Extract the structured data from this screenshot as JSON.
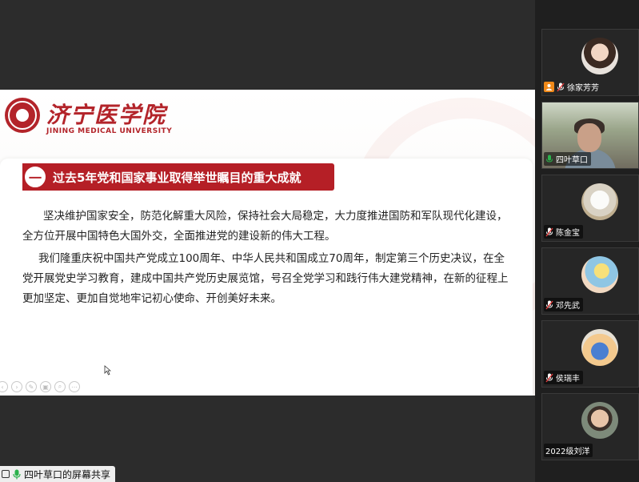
{
  "slide": {
    "logo_cn": "济宁医学院",
    "logo_en": "JINING MEDICAL UNIVERSITY",
    "heading_badge": "一",
    "heading": "过去5年党和国家事业取得举世瞩目的重大成就",
    "paragraph1": "坚决维护国家安全，防范化解重大风险，保持社会大局稳定，大力度推进国防和军队现代化建设，全方位开展中国特色大国外交，全面推进党的建设新的伟大工程。",
    "paragraph2": "我们隆重庆祝中国共产党成立100周年、中华人民共和国成立70周年，制定第三个历史决议，在全党开展党史学习教育，建成中国共产党历史展览馆，号召全党学习和践行伟大建党精神，在新的征程上更加坚定、更加自觉地牢记初心使命、开创美好未来。",
    "controls": [
      "‹",
      "›",
      "✎",
      "▣",
      "⌕",
      "⋯"
    ]
  },
  "screen_share_label": "四叶草口的屏幕共享",
  "participants": [
    {
      "name": "徐家芳芳",
      "avatar": "woman-photo",
      "host": true,
      "mic": "muted"
    },
    {
      "name": "四叶草口",
      "avatar": "video",
      "host": false,
      "mic": "on",
      "active": true
    },
    {
      "name": "陈金宝",
      "avatar": "dog-photo",
      "host": false,
      "mic": "muted"
    },
    {
      "name": "邓先武",
      "avatar": "anime-photo",
      "host": false,
      "mic": "muted"
    },
    {
      "name": "侯瑞丰",
      "avatar": "cartoon-photo",
      "host": false,
      "mic": "muted"
    },
    {
      "name": "2022级刘洋",
      "avatar": "baby-photo",
      "host": false,
      "mic": "none"
    }
  ],
  "colors": {
    "brand": "#b51f26",
    "mic_on": "#2bb24c",
    "host_badge": "#f08a1a"
  }
}
